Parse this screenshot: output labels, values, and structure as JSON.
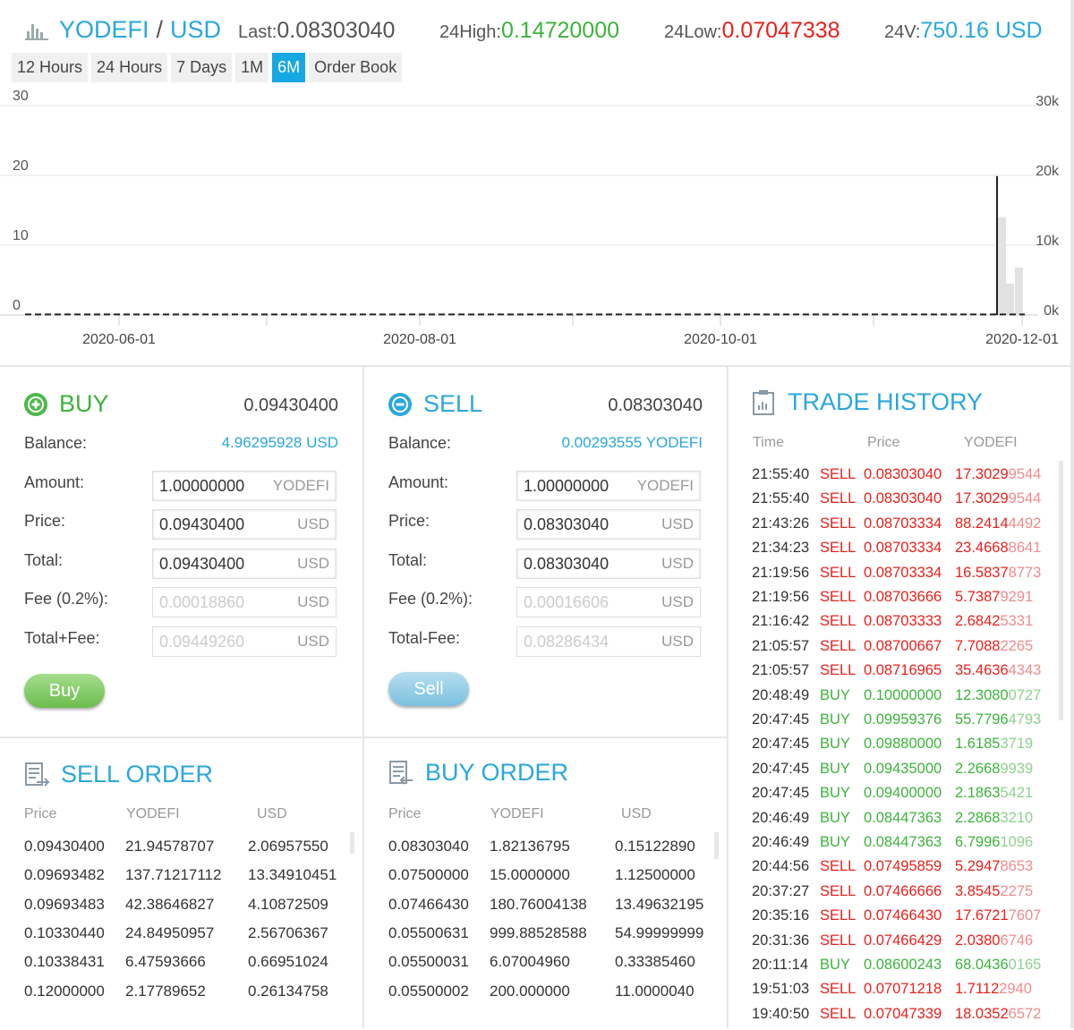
{
  "header": {
    "base": "YODEFI",
    "quote": "USD",
    "last_label": "Last:",
    "last_value": "0.08303040",
    "high_label": "24High:",
    "high_value": "0.14720000",
    "low_label": "24Low:",
    "low_value": "0.07047338",
    "vol_label": "24V:",
    "vol_value": "750.16 USD"
  },
  "tabs": [
    "12 Hours",
    "24 Hours",
    "7 Days",
    "1M",
    "6M",
    "Order Book"
  ],
  "active_tab": "6M",
  "chart_data": {
    "type": "line",
    "left_axis_ticks": [
      "30",
      "20",
      "10",
      "0"
    ],
    "left_ylim": [
      0,
      30
    ],
    "right_axis_ticks": [
      "30k",
      "20k",
      "10k",
      "0k"
    ],
    "right_ylim": [
      0,
      30000
    ],
    "x_ticks": [
      "2020-06-01",
      "2020-08-01",
      "2020-10-01",
      "2020-12-01"
    ],
    "price_series": {
      "style": "dashed",
      "value": 0.08
    },
    "high_low_wick": {
      "low": 0,
      "high": 19.9
    },
    "volume_bars": [
      14000,
      4500,
      6800
    ],
    "grid": true
  },
  "buy": {
    "title": "BUY",
    "price": "0.09430400",
    "balance_label": "Balance:",
    "balance_value": "4.96295928 USD",
    "amount_label": "Amount:",
    "amount_value": "1.00000000",
    "amount_unit": "YODEFI",
    "price_label": "Price:",
    "price_value": "0.09430400",
    "price_unit": "USD",
    "total_label": "Total:",
    "total_value": "0.09430400",
    "total_unit": "USD",
    "fee_label": "Fee (0.2%):",
    "fee_value": "0.00018860",
    "fee_unit": "USD",
    "totalfee_label": "Total+Fee:",
    "totalfee_value": "0.09449260",
    "totalfee_unit": "USD",
    "button": "Buy"
  },
  "sell": {
    "title": "SELL",
    "price": "0.08303040",
    "balance_label": "Balance:",
    "balance_value": "0.00293555 YODEFI",
    "amount_label": "Amount:",
    "amount_value": "1.00000000",
    "amount_unit": "YODEFI",
    "price_label": "Price:",
    "price_value": "0.08303040",
    "price_unit": "USD",
    "total_label": "Total:",
    "total_value": "0.08303040",
    "total_unit": "USD",
    "fee_label": "Fee (0.2%):",
    "fee_value": "0.00016606",
    "fee_unit": "USD",
    "totalfee_label": "Total-Fee:",
    "totalfee_value": "0.08286434",
    "totalfee_unit": "USD",
    "button": "Sell"
  },
  "sell_order": {
    "title": "SELL ORDER",
    "headers": [
      "Price",
      "YODEFI",
      "USD"
    ],
    "rows": [
      [
        "0.09430400",
        "21.94578707",
        "2.06957550"
      ],
      [
        "0.09693482",
        "137.71217112",
        "13.34910451"
      ],
      [
        "0.09693483",
        "42.38646827",
        "4.10872509"
      ],
      [
        "0.10330440",
        "24.84950957",
        "2.56706367"
      ],
      [
        "0.10338431",
        "6.47593666",
        "0.66951024"
      ],
      [
        "0.12000000",
        "2.17789652",
        "0.26134758"
      ]
    ]
  },
  "buy_order": {
    "title": "BUY ORDER",
    "headers": [
      "Price",
      "YODEFI",
      "USD"
    ],
    "rows": [
      [
        "0.08303040",
        "1.82136795",
        "0.15122890"
      ],
      [
        "0.07500000",
        "15.0000000",
        "1.12500000"
      ],
      [
        "0.07466430",
        "180.76004138",
        "13.49632195"
      ],
      [
        "0.05500631",
        "999.88528588",
        "54.99999999"
      ],
      [
        "0.05500031",
        "6.07004960",
        "0.33385460"
      ],
      [
        "0.05500002",
        "200.000000",
        "11.0000040"
      ]
    ]
  },
  "trade_history": {
    "title": "TRADE HISTORY",
    "headers": [
      "Time",
      "Price",
      "YODEFI"
    ],
    "colors": {
      "SELL": "#e8211c",
      "BUY": "#3cb33c",
      "SELL_light": "#f08b8b",
      "BUY_light": "#8fd08f"
    },
    "rows": [
      [
        "21:55:40",
        "SELL",
        "0.08303040",
        "17.30299544"
      ],
      [
        "21:55:40",
        "SELL",
        "0.08303040",
        "17.30299544"
      ],
      [
        "21:43:26",
        "SELL",
        "0.08703334",
        "88.24144492"
      ],
      [
        "21:34:23",
        "SELL",
        "0.08703334",
        "23.46688641"
      ],
      [
        "21:19:56",
        "SELL",
        "0.08703334",
        "16.58378773"
      ],
      [
        "21:19:56",
        "SELL",
        "0.08703666",
        "5.73879291"
      ],
      [
        "21:16:42",
        "SELL",
        "0.08703333",
        "2.68425331"
      ],
      [
        "21:05:57",
        "SELL",
        "0.08700667",
        "7.70882265"
      ],
      [
        "21:05:57",
        "SELL",
        "0.08716965",
        "35.46364343"
      ],
      [
        "20:48:49",
        "BUY",
        "0.10000000",
        "12.30800727"
      ],
      [
        "20:47:45",
        "BUY",
        "0.09959376",
        "55.77964793"
      ],
      [
        "20:47:45",
        "BUY",
        "0.09880000",
        "1.61853719"
      ],
      [
        "20:47:45",
        "BUY",
        "0.09435000",
        "2.26689939"
      ],
      [
        "20:47:45",
        "BUY",
        "0.09400000",
        "2.18635421"
      ],
      [
        "20:46:49",
        "BUY",
        "0.08447363",
        "2.28683210"
      ],
      [
        "20:46:49",
        "BUY",
        "0.08447363",
        "6.79961096"
      ],
      [
        "20:44:56",
        "SELL",
        "0.07495859",
        "5.29478653"
      ],
      [
        "20:37:27",
        "SELL",
        "0.07466666",
        "3.85452275"
      ],
      [
        "20:35:16",
        "SELL",
        "0.07466430",
        "17.67217607"
      ],
      [
        "20:31:36",
        "SELL",
        "0.07466429",
        "2.03806746"
      ],
      [
        "20:11:14",
        "BUY",
        "0.08600243",
        "68.04360165"
      ],
      [
        "19:51:03",
        "SELL",
        "0.07071218",
        "1.71122940"
      ],
      [
        "19:40:50",
        "SELL",
        "0.07047339",
        "18.03526572"
      ]
    ]
  }
}
